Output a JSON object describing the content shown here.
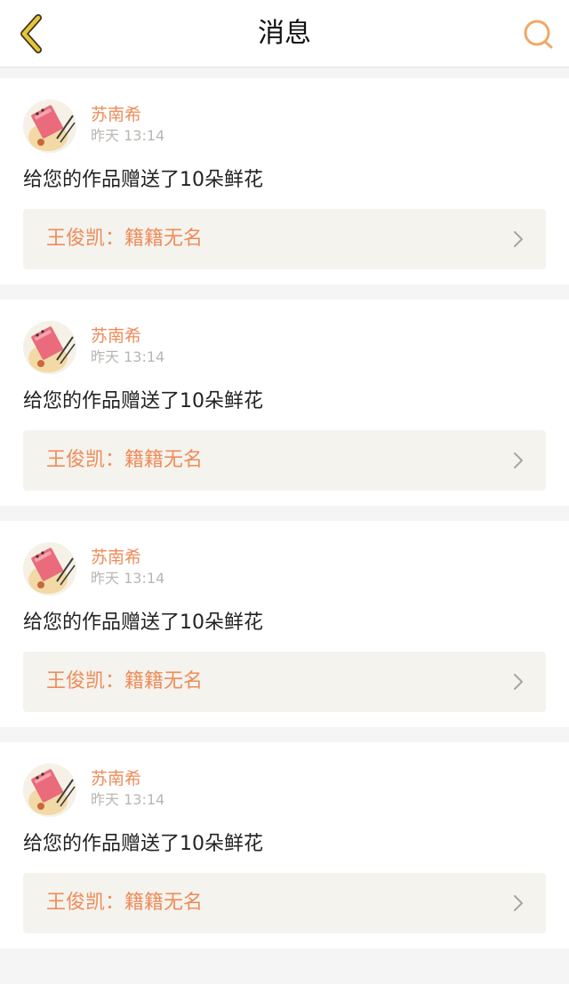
{
  "header": {
    "title": "消息",
    "back_icon": "chevron-left-icon",
    "search_icon": "search-icon",
    "accent_color": "#f0a868",
    "back_color": "#e8c53a"
  },
  "messages": [
    {
      "sender": "苏南希",
      "time": "昨天 13:14",
      "text": "给您的作品赠送了10朵鲜花",
      "work_label": "王俊凯：籍籍无名"
    },
    {
      "sender": "苏南希",
      "time": "昨天 13:14",
      "text": "给您的作品赠送了10朵鲜花",
      "work_label": "王俊凯：籍籍无名"
    },
    {
      "sender": "苏南希",
      "time": "昨天 13:14",
      "text": "给您的作品赠送了10朵鲜花",
      "work_label": "王俊凯：籍籍无名"
    },
    {
      "sender": "苏南希",
      "time": "昨天 13:14",
      "text": "给您的作品赠送了10朵鲜花",
      "work_label": "王俊凯：籍籍无名"
    }
  ],
  "colors": {
    "name": "#ee8c5a",
    "timestamp": "#b9b6b2",
    "link_bg": "#f4f3ee",
    "page_bg": "#f6f5f5"
  }
}
